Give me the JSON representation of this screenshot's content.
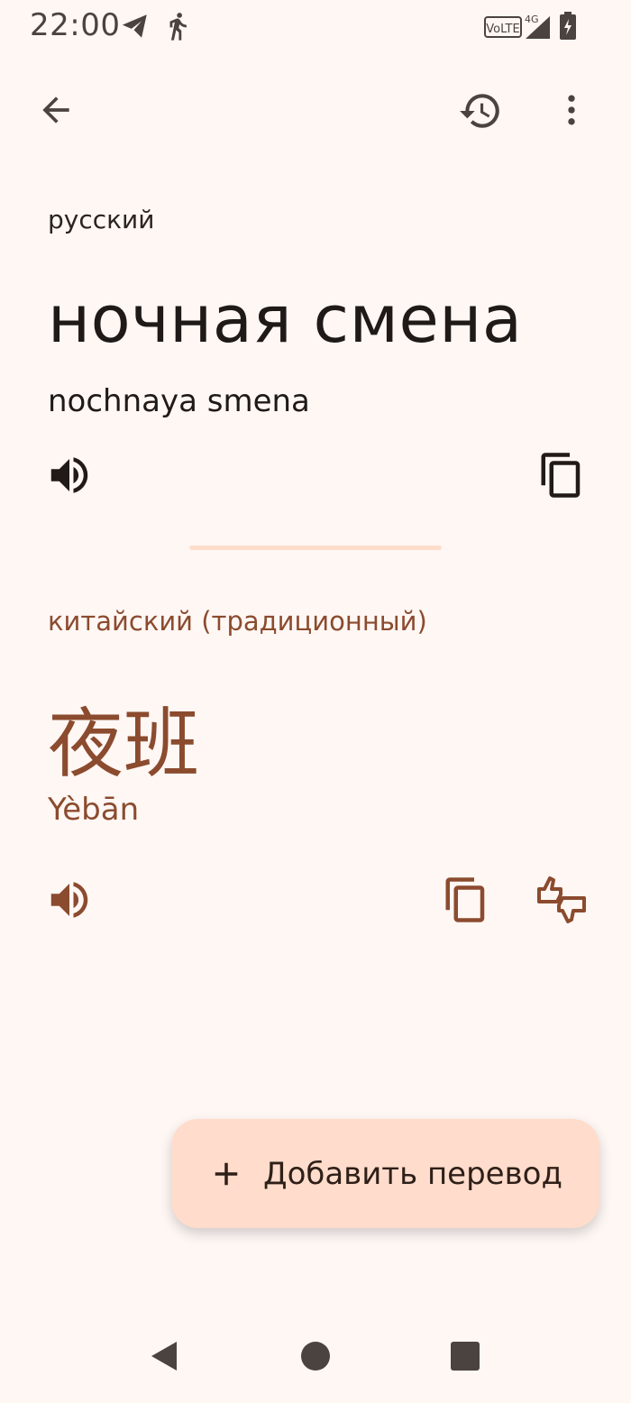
{
  "status_bar": {
    "time": "22:00",
    "icons": [
      "telegram-icon",
      "walking-icon",
      "volte-icon",
      "signal-4g-icon",
      "battery-charging-icon"
    ],
    "network_badge": "VoLTE",
    "network_type": "4G"
  },
  "toolbar": {
    "back_icon": "arrow-back-icon",
    "history_icon": "history-icon",
    "more_icon": "more-vert-icon"
  },
  "source": {
    "language": "русский",
    "text": "ночная смена",
    "transliteration": "nochnaya smena"
  },
  "target": {
    "language": "китайский (традиционный)",
    "text": "夜班",
    "transliteration": "Yèbān"
  },
  "fab": {
    "label": "Добавить перевод",
    "icon": "plus-icon"
  },
  "colors": {
    "background": "#FFF7F4",
    "accent": "#8B4B2E",
    "fab_background": "#FFDCCB",
    "divider": "#FFDDCB"
  }
}
